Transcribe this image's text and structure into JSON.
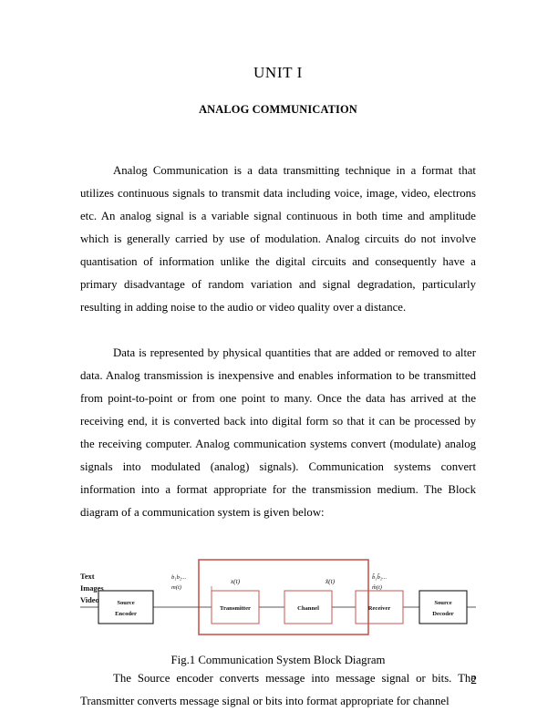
{
  "document": {
    "unit_title": "UNIT I",
    "section_title": "ANALOG COMMUNICATION",
    "page_number": "2"
  },
  "paragraphs": {
    "p1": "Analog Communication is a data transmitting technique in a format that utilizes continuous signals to transmit data including voice, image, video, electrons etc. An analog signal is a variable signal continuous in both time and amplitude which is generally carried by use of modulation. Analog circuits do not involve quantisation of information unlike the digital circuits and consequently have a primary disadvantage of random variation and signal degradation, particularly resulting in adding noise to the audio or video quality over a distance.",
    "p2": "Data is represented by physical quantities that are added or removed to alter data. Analog transmission is inexpensive and enables information to be transmitted from point-to-point or from one point to many. Once the data has arrived at the receiving end, it is converted back into digital form so that it can be processed by the receiving computer. Analog communication systems convert (modulate) analog signals into modulated (analog) signals). Communication systems convert information into a format appropriate for the transmission medium. The Block diagram of a communication system is given below:",
    "p3": "The Source encoder converts message into message signal or bits. The Transmitter converts message signal or bits into format appropriate for channel"
  },
  "figure": {
    "caption": "Fig.1 Communication System Block Diagram",
    "input_labels": [
      "Text",
      "Images",
      "Video"
    ],
    "blocks": [
      {
        "id": "source-encoder",
        "line1": "Source",
        "line2": "Encoder",
        "border_color": "#1a1a1a"
      },
      {
        "id": "transmitter",
        "line1": "Transmitter",
        "line2": "",
        "border_color": "#c9564f"
      },
      {
        "id": "channel",
        "line1": "Channel",
        "line2": "",
        "border_color": "#c9564f"
      },
      {
        "id": "receiver",
        "line1": "Receiver",
        "line2": "",
        "border_color": "#c9564f"
      },
      {
        "id": "source-decoder",
        "line1": "Source",
        "line2": "Decoder",
        "border_color": "#1a1a1a"
      }
    ],
    "signal_labels": {
      "encoder_out_bits": "b₁b₂...",
      "encoder_out_msg": "m(t)",
      "transmitted": "x(t)",
      "received": "x̂(t)",
      "decoder_in_bits": "b̂₁b̂₂...",
      "decoder_in_msg": "m̂(t)"
    },
    "outer_boundary_color": "#c9564f",
    "line_color": "#5a5a5a"
  }
}
